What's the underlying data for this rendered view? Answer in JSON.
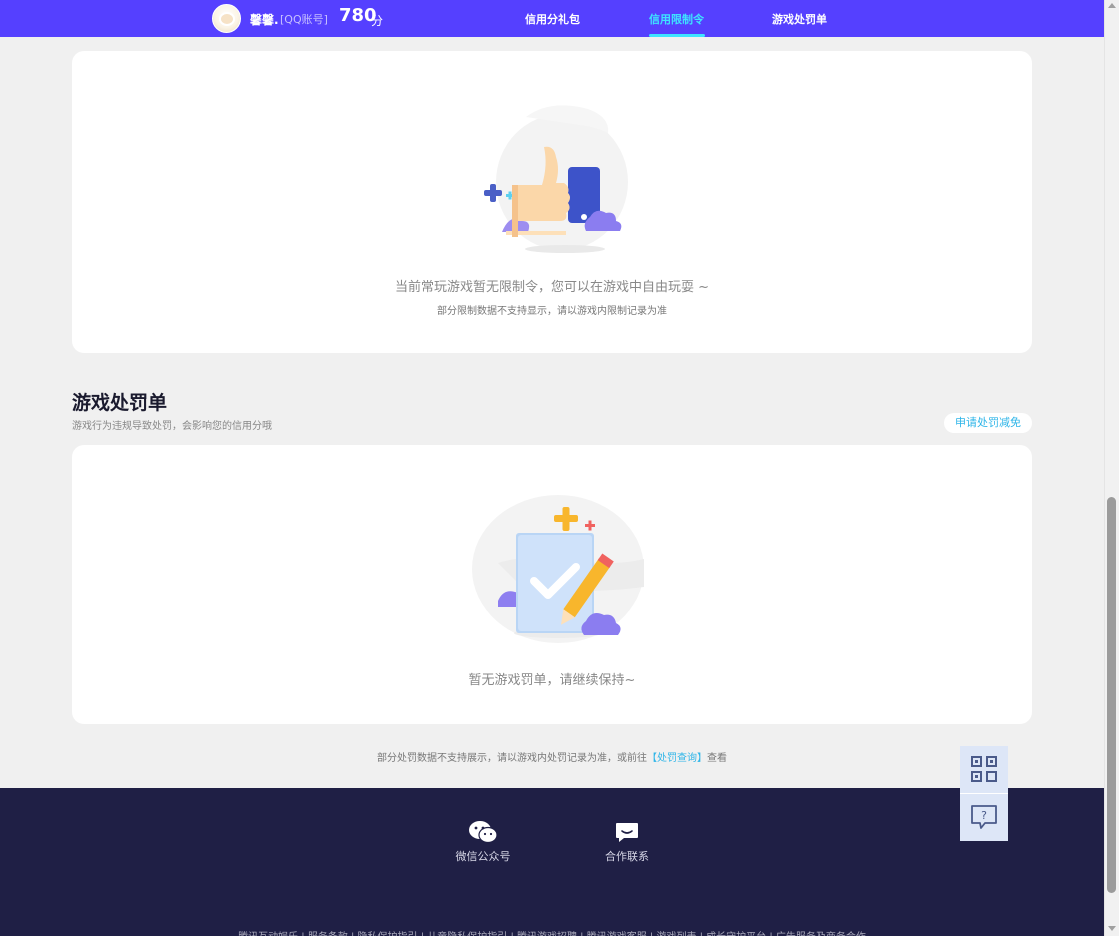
{
  "header": {
    "nickname": "馨馨.",
    "account_type": "[QQ账号]",
    "score": "780",
    "score_unit": "分",
    "nav": [
      {
        "label": "信用分礼包",
        "active": false
      },
      {
        "label": "信用限制令",
        "active": true
      },
      {
        "label": "游戏处罚单",
        "active": false
      }
    ]
  },
  "restriction_card": {
    "illustration": "thumbs-up-illustration",
    "message": "当前常玩游戏暂无限制令，您可以在游戏中自由玩耍 ~",
    "note": "部分限制数据不支持显示，请以游戏内限制记录为准"
  },
  "penalty_section": {
    "title": "游戏处罚单",
    "description": "游戏行为违规导致处罚，会影响您的信用分哦",
    "apply_button": "申请处罚减免",
    "illustration": "checklist-illustration",
    "empty_message": "暂无游戏罚单，请继续保持~"
  },
  "notice": {
    "prefix": "部分处罚数据不支持展示，请以游戏内处罚记录为准，或前往",
    "link": "【处罚查询】",
    "suffix": "查看"
  },
  "footer": {
    "items": [
      {
        "icon": "wechat-icon",
        "label": "微信公众号"
      },
      {
        "icon": "chat-icon",
        "label": "合作联系"
      }
    ],
    "links": "腾讯互动娱乐 | 服务条款 | 隐私保护指引 | 儿童隐私保护指引 | 腾讯游戏招聘 | 腾讯游戏客服 | 游戏列表 | 成长守护平台 | 广告服务及商务合作"
  },
  "floating": {
    "qr_icon": "qr-code-icon",
    "help_icon": "help-chat-icon"
  },
  "colors": {
    "header_bg": "#5540ff",
    "active_nav": "#3ee3ff",
    "link": "#2eb5e8",
    "footer_bg": "#1f1f45"
  }
}
